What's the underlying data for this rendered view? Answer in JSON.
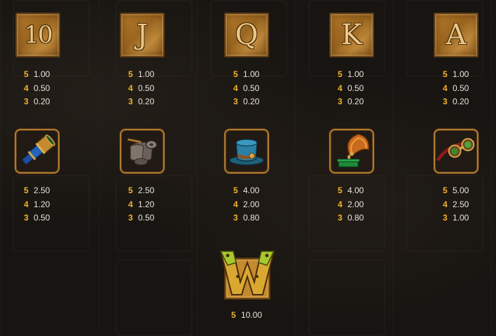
{
  "paytable": {
    "row1": [
      {
        "symbol": "10",
        "icon": "card-ten-icon",
        "pays": [
          {
            "count": "5",
            "value": "1.00"
          },
          {
            "count": "4",
            "value": "0.50"
          },
          {
            "count": "3",
            "value": "0.20"
          }
        ]
      },
      {
        "symbol": "J",
        "icon": "card-jack-icon",
        "pays": [
          {
            "count": "5",
            "value": "1.00"
          },
          {
            "count": "4",
            "value": "0.50"
          },
          {
            "count": "3",
            "value": "0.20"
          }
        ]
      },
      {
        "symbol": "Q",
        "icon": "card-queen-icon",
        "pays": [
          {
            "count": "5",
            "value": "1.00"
          },
          {
            "count": "4",
            "value": "0.50"
          },
          {
            "count": "3",
            "value": "0.20"
          }
        ]
      },
      {
        "symbol": "K",
        "icon": "card-king-icon",
        "pays": [
          {
            "count": "5",
            "value": "1.00"
          },
          {
            "count": "4",
            "value": "0.50"
          },
          {
            "count": "3",
            "value": "0.20"
          }
        ]
      },
      {
        "symbol": "A",
        "icon": "card-ace-icon",
        "pays": [
          {
            "count": "5",
            "value": "1.00"
          },
          {
            "count": "4",
            "value": "0.50"
          },
          {
            "count": "3",
            "value": "0.20"
          }
        ]
      }
    ],
    "row2": [
      {
        "icon": "telescope-icon",
        "pays": [
          {
            "count": "5",
            "value": "2.50"
          },
          {
            "count": "4",
            "value": "1.20"
          },
          {
            "count": "3",
            "value": "0.50"
          }
        ]
      },
      {
        "icon": "scroll-icon",
        "pays": [
          {
            "count": "5",
            "value": "2.50"
          },
          {
            "count": "4",
            "value": "1.20"
          },
          {
            "count": "3",
            "value": "0.50"
          }
        ]
      },
      {
        "icon": "top-hat-icon",
        "pays": [
          {
            "count": "5",
            "value": "4.00"
          },
          {
            "count": "4",
            "value": "2.00"
          },
          {
            "count": "3",
            "value": "0.80"
          }
        ]
      },
      {
        "icon": "gramophone-icon",
        "pays": [
          {
            "count": "5",
            "value": "4.00"
          },
          {
            "count": "4",
            "value": "2.00"
          },
          {
            "count": "3",
            "value": "0.80"
          }
        ]
      },
      {
        "icon": "goggles-icon",
        "pays": [
          {
            "count": "5",
            "value": "5.00"
          },
          {
            "count": "4",
            "value": "2.50"
          },
          {
            "count": "3",
            "value": "1.00"
          }
        ]
      }
    ],
    "wild": {
      "symbol": "W",
      "icon": "wild-w-icon",
      "pays": [
        {
          "count": "5",
          "value": "10.00"
        }
      ]
    }
  },
  "colors": {
    "count": "#f2b32a",
    "value": "#e9e4dc",
    "gold": "#b07a32",
    "background": "#171411"
  }
}
